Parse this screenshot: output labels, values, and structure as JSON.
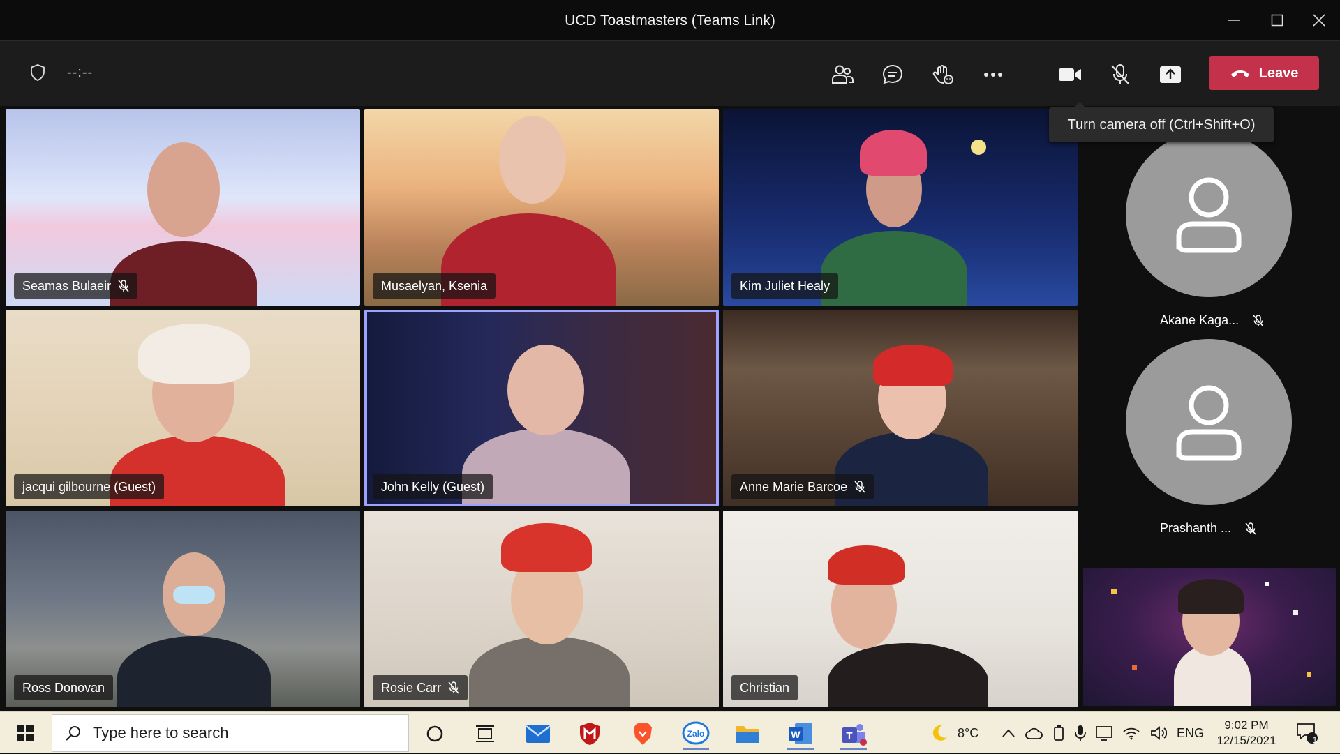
{
  "window": {
    "title": "UCD Toastmasters (Teams Link)"
  },
  "toolbar": {
    "timer": "--:--",
    "leave_label": "Leave",
    "camera_tooltip": "Turn camera off (Ctrl+Shift+O)",
    "leave_color": "#c4314b"
  },
  "participants": [
    {
      "name": "Seamas Bulaeir",
      "muted": true
    },
    {
      "name": "Musaelyan, Ksenia",
      "muted": false
    },
    {
      "name": "Kim Juliet Healy",
      "muted": false
    },
    {
      "name": "jacqui gilbourne (Guest)",
      "muted": false
    },
    {
      "name": "John Kelly (Guest)",
      "muted": false,
      "speaking": true
    },
    {
      "name": "Anne Marie Barcoe",
      "muted": true
    },
    {
      "name": "Ross Donovan",
      "muted": false
    },
    {
      "name": "Rosie Carr",
      "muted": true
    },
    {
      "name": "Christian",
      "muted": false
    }
  ],
  "side_participants": [
    {
      "name": "Akane Kaga...",
      "muted": true
    },
    {
      "name": "Prashanth ...",
      "muted": true
    }
  ],
  "taskbar": {
    "search_placeholder": "Type here to search",
    "weather": "8°C",
    "language": "ENG",
    "time": "9:02 PM",
    "date": "12/15/2021",
    "notification_count": "1",
    "pinned_apps": [
      "task-view",
      "mail",
      "mcafee",
      "brave",
      "zalo",
      "file-explorer",
      "word",
      "teams"
    ]
  },
  "colors": {
    "speaking_border": "#9ea2ff",
    "avatar_gray": "#9b9b9b",
    "taskbar_bg": "#f3eedc"
  }
}
